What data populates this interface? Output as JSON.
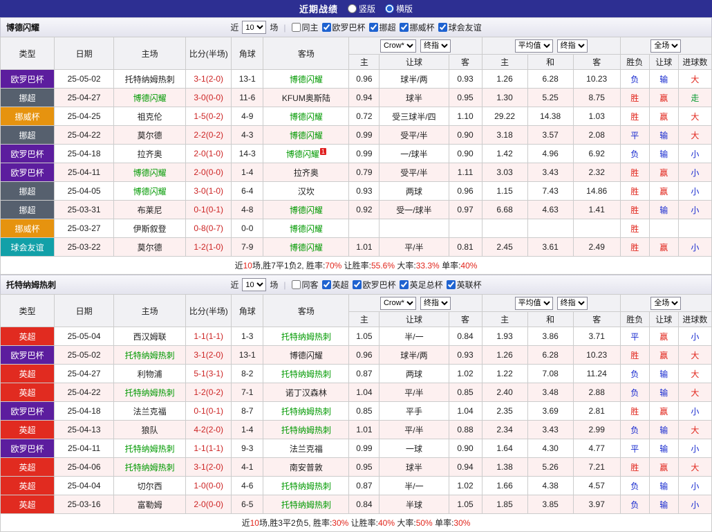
{
  "topbar": {
    "title": "近期战绩",
    "radios": {
      "vertical": "竖版",
      "horizontal": "横版",
      "selected": "horizontal"
    }
  },
  "filter_labels": {
    "near": "近",
    "games": "场"
  },
  "shared_header": {
    "type": "类型",
    "date": "日期",
    "home": "主场",
    "score": "比分(半场)",
    "corner": "角球",
    "away": "客场",
    "bookmaker_select": "Crow*",
    "final_select": "终指",
    "avg_select": "平均值",
    "scope_select": "全场",
    "sub": {
      "h_home": "主",
      "h_line": "让球",
      "h_away": "客",
      "e_home": "主",
      "e_draw": "和",
      "e_away": "客",
      "r_outcome": "胜负",
      "r_handicap": "让球",
      "r_goals": "进球数"
    }
  },
  "league_colors": {
    "欧罗巴杯": "#5c1d9e",
    "挪超": "#56606e",
    "挪威杯": "#e6930f",
    "球会友谊": "#12a0a8",
    "英超": "#e12b20"
  },
  "result_colors": {
    "胜": "#e1251b",
    "赢": "#e1251b",
    "大": "#e1251b",
    "平": "#1427ce",
    "负": "#1427ce",
    "输": "#1427ce",
    "小": "#1427ce",
    "走": "#0a9a32"
  },
  "colors": {
    "topbar_bg": "#2d2f92",
    "summary_red": "#e1251b",
    "score": "#cc2222",
    "focus_team": "#009900",
    "alt_row": "#fdf0f0"
  },
  "tables": [
    {
      "team": "博德闪耀",
      "filter": {
        "count": "10",
        "same_label": "同主",
        "same_checked": false,
        "leagues": [
          "欧罗巴杯",
          "挪超",
          "挪威杯",
          "球会友谊"
        ]
      },
      "rows": [
        {
          "league": "欧罗巴杯",
          "date": "25-05-02",
          "home": "托特纳姆热刺",
          "home_focus": false,
          "score": "3-1(2-0)",
          "corner": "13-1",
          "away": "博德闪耀",
          "away_focus": true,
          "away_sup": "",
          "h1": "0.96",
          "line": "球半/两",
          "h2": "0.93",
          "o1": "1.26",
          "o2": "6.28",
          "o3": "10.23",
          "r1": "负",
          "r2": "输",
          "r3": "大"
        },
        {
          "league": "挪超",
          "date": "25-04-27",
          "home": "博德闪耀",
          "home_focus": true,
          "score": "3-0(0-0)",
          "corner": "11-6",
          "away": "KFUM奥斯陆",
          "away_focus": false,
          "away_sup": "",
          "h1": "0.94",
          "line": "球半",
          "h2": "0.95",
          "o1": "1.30",
          "o2": "5.25",
          "o3": "8.75",
          "r1": "胜",
          "r2": "赢",
          "r3": "走"
        },
        {
          "league": "挪威杯",
          "date": "25-04-25",
          "home": "祖克伦",
          "home_focus": false,
          "score": "1-5(0-2)",
          "corner": "4-9",
          "away": "博德闪耀",
          "away_focus": true,
          "away_sup": "",
          "h1": "0.72",
          "line": "受三球半/四",
          "h2": "1.10",
          "o1": "29.22",
          "o2": "14.38",
          "o3": "1.03",
          "r1": "胜",
          "r2": "赢",
          "r3": "大"
        },
        {
          "league": "挪超",
          "date": "25-04-22",
          "home": "莫尔德",
          "home_focus": false,
          "score": "2-2(0-2)",
          "corner": "4-3",
          "away": "博德闪耀",
          "away_focus": true,
          "away_sup": "",
          "h1": "0.99",
          "line": "受平/半",
          "h2": "0.90",
          "o1": "3.18",
          "o2": "3.57",
          "o3": "2.08",
          "r1": "平",
          "r2": "输",
          "r3": "大"
        },
        {
          "league": "欧罗巴杯",
          "date": "25-04-18",
          "home": "拉齐奥",
          "home_focus": false,
          "score": "2-0(1-0)",
          "corner": "14-3",
          "away": "博德闪耀",
          "away_focus": true,
          "away_sup": "1",
          "h1": "0.99",
          "line": "一/球半",
          "h2": "0.90",
          "o1": "1.42",
          "o2": "4.96",
          "o3": "6.92",
          "r1": "负",
          "r2": "输",
          "r3": "小"
        },
        {
          "league": "欧罗巴杯",
          "date": "25-04-11",
          "home": "博德闪耀",
          "home_focus": true,
          "score": "2-0(0-0)",
          "corner": "1-4",
          "away": "拉齐奥",
          "away_focus": false,
          "away_sup": "",
          "h1": "0.79",
          "line": "受平/半",
          "h2": "1.11",
          "o1": "3.03",
          "o2": "3.43",
          "o3": "2.32",
          "r1": "胜",
          "r2": "赢",
          "r3": "小"
        },
        {
          "league": "挪超",
          "date": "25-04-05",
          "home": "博德闪耀",
          "home_focus": true,
          "score": "3-0(1-0)",
          "corner": "6-4",
          "away": "汉坎",
          "away_focus": false,
          "away_sup": "",
          "h1": "0.93",
          "line": "两球",
          "h2": "0.96",
          "o1": "1.15",
          "o2": "7.43",
          "o3": "14.86",
          "r1": "胜",
          "r2": "赢",
          "r3": "小"
        },
        {
          "league": "挪超",
          "date": "25-03-31",
          "home": "布莱尼",
          "home_focus": false,
          "score": "0-1(0-1)",
          "corner": "4-8",
          "away": "博德闪耀",
          "away_focus": true,
          "away_sup": "",
          "h1": "0.92",
          "line": "受一/球半",
          "h2": "0.97",
          "o1": "6.68",
          "o2": "4.63",
          "o3": "1.41",
          "r1": "胜",
          "r2": "输",
          "r3": "小"
        },
        {
          "league": "挪威杯",
          "date": "25-03-27",
          "home": "伊斯叙登",
          "home_focus": false,
          "score": "0-8(0-7)",
          "corner": "0-0",
          "away": "博德闪耀",
          "away_focus": true,
          "away_sup": "",
          "h1": "",
          "line": "",
          "h2": "",
          "o1": "",
          "o2": "",
          "o3": "",
          "r1": "胜",
          "r2": "",
          "r3": ""
        },
        {
          "league": "球会友谊",
          "date": "25-03-22",
          "home": "莫尔德",
          "home_focus": false,
          "score": "1-2(1-0)",
          "corner": "7-9",
          "away": "博德闪耀",
          "away_focus": true,
          "away_sup": "",
          "h1": "1.01",
          "line": "平/半",
          "h2": "0.81",
          "o1": "2.45",
          "o2": "3.61",
          "o3": "2.49",
          "r1": "胜",
          "r2": "赢",
          "r3": "小"
        }
      ],
      "summary": [
        {
          "t": "近",
          "c": "black"
        },
        {
          "t": "10",
          "c": "red"
        },
        {
          "t": "场,胜7平1负2, 胜率:",
          "c": "black"
        },
        {
          "t": "70%",
          "c": "red"
        },
        {
          "t": " 让胜率:",
          "c": "black"
        },
        {
          "t": "55.6%",
          "c": "red"
        },
        {
          "t": " 大率:",
          "c": "black"
        },
        {
          "t": "33.3%",
          "c": "red"
        },
        {
          "t": " 单率:",
          "c": "black"
        },
        {
          "t": "40%",
          "c": "red"
        }
      ]
    },
    {
      "team": "托特纳姆热刺",
      "filter": {
        "count": "10",
        "same_label": "同客",
        "same_checked": false,
        "leagues": [
          "英超",
          "欧罗巴杯",
          "英足总杯",
          "英联杯"
        ]
      },
      "rows": [
        {
          "league": "英超",
          "date": "25-05-04",
          "home": "西汉姆联",
          "home_focus": false,
          "score": "1-1(1-1)",
          "corner": "1-3",
          "away": "托特纳姆热刺",
          "away_focus": true,
          "away_sup": "",
          "h1": "1.05",
          "line": "半/一",
          "h2": "0.84",
          "o1": "1.93",
          "o2": "3.86",
          "o3": "3.71",
          "r1": "平",
          "r2": "赢",
          "r3": "小"
        },
        {
          "league": "欧罗巴杯",
          "date": "25-05-02",
          "home": "托特纳姆热刺",
          "home_focus": true,
          "score": "3-1(2-0)",
          "corner": "13-1",
          "away": "博德闪耀",
          "away_focus": false,
          "away_sup": "",
          "h1": "0.96",
          "line": "球半/两",
          "h2": "0.93",
          "o1": "1.26",
          "o2": "6.28",
          "o3": "10.23",
          "r1": "胜",
          "r2": "赢",
          "r3": "大"
        },
        {
          "league": "英超",
          "date": "25-04-27",
          "home": "利物浦",
          "home_focus": false,
          "score": "5-1(3-1)",
          "corner": "8-2",
          "away": "托特纳姆热刺",
          "away_focus": true,
          "away_sup": "",
          "h1": "0.87",
          "line": "两球",
          "h2": "1.02",
          "o1": "1.22",
          "o2": "7.08",
          "o3": "11.24",
          "r1": "负",
          "r2": "输",
          "r3": "大"
        },
        {
          "league": "英超",
          "date": "25-04-22",
          "home": "托特纳姆热刺",
          "home_focus": true,
          "score": "1-2(0-2)",
          "corner": "7-1",
          "away": "诺丁汉森林",
          "away_focus": false,
          "away_sup": "",
          "h1": "1.04",
          "line": "平/半",
          "h2": "0.85",
          "o1": "2.40",
          "o2": "3.48",
          "o3": "2.88",
          "r1": "负",
          "r2": "输",
          "r3": "大"
        },
        {
          "league": "欧罗巴杯",
          "date": "25-04-18",
          "home": "法兰克福",
          "home_focus": false,
          "score": "0-1(0-1)",
          "corner": "8-7",
          "away": "托特纳姆热刺",
          "away_focus": true,
          "away_sup": "",
          "h1": "0.85",
          "line": "平手",
          "h2": "1.04",
          "o1": "2.35",
          "o2": "3.69",
          "o3": "2.81",
          "r1": "胜",
          "r2": "赢",
          "r3": "小"
        },
        {
          "league": "英超",
          "date": "25-04-13",
          "home": "狼队",
          "home_focus": false,
          "score": "4-2(2-0)",
          "corner": "1-4",
          "away": "托特纳姆热刺",
          "away_focus": true,
          "away_sup": "",
          "h1": "1.01",
          "line": "平/半",
          "h2": "0.88",
          "o1": "2.34",
          "o2": "3.43",
          "o3": "2.99",
          "r1": "负",
          "r2": "输",
          "r3": "大"
        },
        {
          "league": "欧罗巴杯",
          "date": "25-04-11",
          "home": "托特纳姆热刺",
          "home_focus": true,
          "score": "1-1(1-1)",
          "corner": "9-3",
          "away": "法兰克福",
          "away_focus": false,
          "away_sup": "",
          "h1": "0.99",
          "line": "一球",
          "h2": "0.90",
          "o1": "1.64",
          "o2": "4.30",
          "o3": "4.77",
          "r1": "平",
          "r2": "输",
          "r3": "小"
        },
        {
          "league": "英超",
          "date": "25-04-06",
          "home": "托特纳姆热刺",
          "home_focus": true,
          "score": "3-1(2-0)",
          "corner": "4-1",
          "away": "南安普敦",
          "away_focus": false,
          "away_sup": "",
          "h1": "0.95",
          "line": "球半",
          "h2": "0.94",
          "o1": "1.38",
          "o2": "5.26",
          "o3": "7.21",
          "r1": "胜",
          "r2": "赢",
          "r3": "大"
        },
        {
          "league": "英超",
          "date": "25-04-04",
          "home": "切尔西",
          "home_focus": false,
          "score": "1-0(0-0)",
          "corner": "4-6",
          "away": "托特纳姆热刺",
          "away_focus": true,
          "away_sup": "",
          "h1": "0.87",
          "line": "半/一",
          "h2": "1.02",
          "o1": "1.66",
          "o2": "4.38",
          "o3": "4.57",
          "r1": "负",
          "r2": "输",
          "r3": "小"
        },
        {
          "league": "英超",
          "date": "25-03-16",
          "home": "富勒姆",
          "home_focus": false,
          "score": "2-0(0-0)",
          "corner": "6-5",
          "away": "托特纳姆热刺",
          "away_focus": true,
          "away_sup": "",
          "h1": "0.84",
          "line": "半球",
          "h2": "1.05",
          "o1": "1.85",
          "o2": "3.85",
          "o3": "3.97",
          "r1": "负",
          "r2": "输",
          "r3": "小"
        }
      ],
      "summary": [
        {
          "t": "近",
          "c": "black"
        },
        {
          "t": "10",
          "c": "red"
        },
        {
          "t": "场,胜3平2负5, 胜率:",
          "c": "black"
        },
        {
          "t": "30%",
          "c": "red"
        },
        {
          "t": " 让胜率:",
          "c": "black"
        },
        {
          "t": "40%",
          "c": "red"
        },
        {
          "t": " 大率:",
          "c": "black"
        },
        {
          "t": "50%",
          "c": "red"
        },
        {
          "t": " 单率:",
          "c": "black"
        },
        {
          "t": "30%",
          "c": "red"
        }
      ]
    }
  ]
}
